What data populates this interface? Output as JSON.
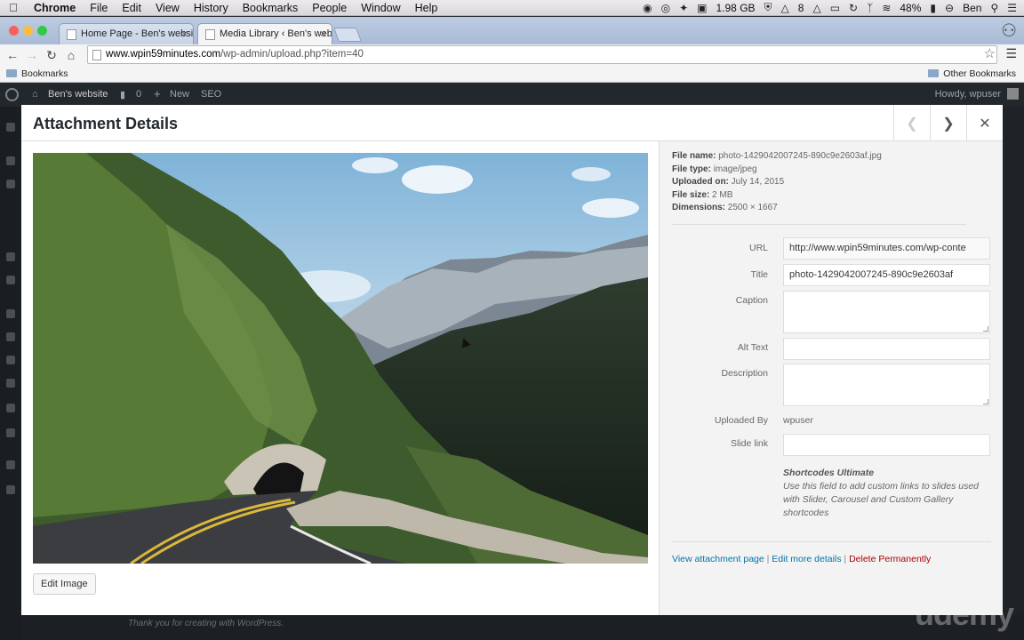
{
  "menubar": {
    "app": "Chrome",
    "items": [
      "File",
      "Edit",
      "View",
      "History",
      "Bookmarks",
      "People",
      "Window",
      "Help"
    ],
    "memory": "1.98 GB",
    "count": "8",
    "battery": "48%",
    "user": "Ben"
  },
  "tabs": [
    {
      "title": "Home Page - Ben's websit",
      "active": false
    },
    {
      "title": "Media Library ‹ Ben's webs",
      "active": true
    }
  ],
  "address": {
    "domain": "www.wpin59minutes.com",
    "path": "/wp-admin/upload.php?item=40"
  },
  "bookmarks": {
    "left": "Bookmarks",
    "right": "Other Bookmarks"
  },
  "adminbar": {
    "site": "Ben's website",
    "comments": "0",
    "new": "New",
    "seo": "SEO",
    "howdy": "Howdy, wpuser"
  },
  "modal": {
    "title": "Attachment Details",
    "edit_image": "Edit Image",
    "file": {
      "name_label": "File name:",
      "name": "photo-1429042007245-890c9e2603af.jpg",
      "type_label": "File type:",
      "type": "image/jpeg",
      "uploaded_label": "Uploaded on:",
      "uploaded": "July 14, 2015",
      "size_label": "File size:",
      "size": "2 MB",
      "dimensions_label": "Dimensions:",
      "dimensions": "2500 × 1667"
    },
    "fields": {
      "url_label": "URL",
      "url": "http://www.wpin59minutes.com/wp-conte",
      "title_label": "Title",
      "title": "photo-1429042007245-890c9e2603af",
      "caption_label": "Caption",
      "caption": "",
      "alt_label": "Alt Text",
      "alt": "",
      "description_label": "Description",
      "description": "",
      "uploaded_by_label": "Uploaded By",
      "uploaded_by": "wpuser",
      "slide_link_label": "Slide link",
      "slide_link": ""
    },
    "shortcodes": {
      "title": "Shortcodes Ultimate",
      "desc": "Use this field to add custom links to slides used with Slider, Carousel and Custom Gallery shortcodes"
    },
    "actions": {
      "view": "View attachment page",
      "sep": "|",
      "edit": "Edit more details",
      "delete": "Delete Permanently"
    }
  },
  "footer": {
    "text": "Thank you for creating with WordPress."
  },
  "watermark": "udemy"
}
